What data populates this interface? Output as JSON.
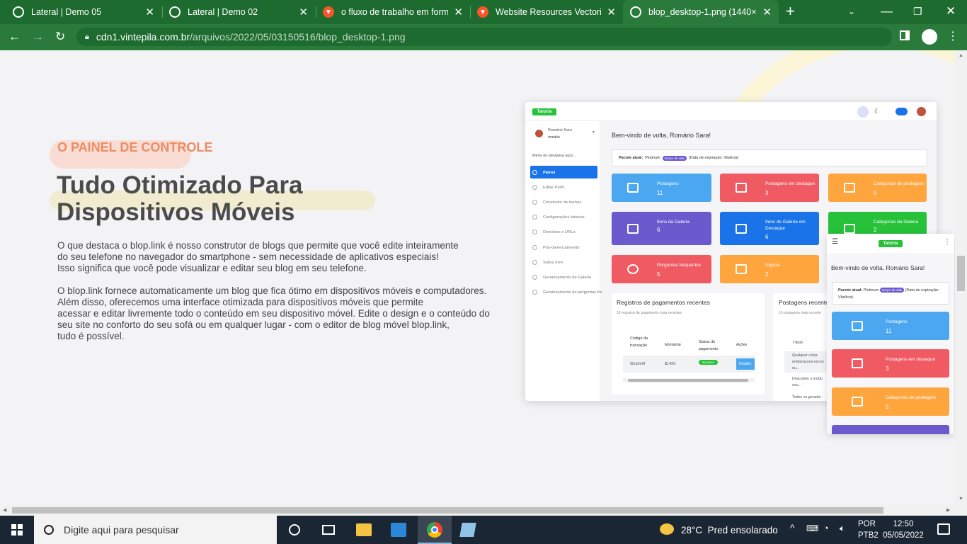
{
  "browser": {
    "tabs": [
      {
        "title": "Lateral | Demo 05",
        "icon": "globe-icon"
      },
      {
        "title": "Lateral | Demo 02",
        "icon": "globe-icon"
      },
      {
        "title": "o fluxo de trabalho em forma",
        "icon": "brave-icon"
      },
      {
        "title": "Website Resources Vectorie!",
        "icon": "brave-icon"
      },
      {
        "title": "blop_desktop-1.png (1440×7",
        "icon": "globe-icon"
      }
    ],
    "url_domain": "cdn1.vintepila.com.br",
    "url_path": "/arquivos/2022/05/03150516/blop_desktop-1.png"
  },
  "page": {
    "eyebrow": "O PAINEL DE CONTROLE",
    "heading_line1": "Tudo Otimizado Para",
    "heading_line2": "Dispositivos Móveis",
    "para1": [
      "O que destaca o blop.link é nosso construtor de blogs que permite que você edite inteiramente",
      "do seu telefone no navegador do smartphone - sem necessidade de aplicativos especiais!",
      "Isso significa que você pode visualizar e editar seu blog em seu telefone."
    ],
    "para2": [
      "O blop.link fornece automaticamente um blog que fica ótimo em dispositivos móveis e computadores.",
      "Além disso, oferecemos uma interface otimizada para dispositivos móveis que permite",
      "acessar e editar livremente todo o conteúdo em seu dispositivo móvel. Edite o design e o conteúdo do",
      "seu site no conforto do seu sofá ou em qualquer lugar - com o editor de blog móvel blop.link,",
      "tudo é possível."
    ]
  },
  "mock": {
    "logo": "Tanzria",
    "user_name": "Romário Sara",
    "user_handle": "romário",
    "search_placeholder": "Menu de pesquisa aqui...",
    "nav": [
      "Painel",
      "Editar Perfil",
      "Construtor de menus",
      "Configurações básicas",
      "Domínios e URLs",
      "Pós-Gerenciamento",
      "Sobre mim",
      "Gerenciamento de Galeria",
      "Gerenciamento de perguntas fre"
    ],
    "welcome": "Bem-vindo de volta, Romário Sara!",
    "package_label": "Pacote atual:",
    "package_name": "Plutinum",
    "package_badge": "tempo de vida",
    "package_expiry": "(Data de expiração: Vitalícia)",
    "cards": [
      {
        "label": "Postagens",
        "value": "11",
        "color": "#4ba8f0"
      },
      {
        "label": "Postagens em destaque",
        "value": "3",
        "color": "#ef5a63"
      },
      {
        "label": "Categorias de postagem",
        "value": "5",
        "color": "#ffa53d"
      },
      {
        "label": "Itens da Galeria",
        "value": "6",
        "color": "#6a5acd"
      },
      {
        "label": "Itens de Galeria em Destaque",
        "value": "6",
        "color": "#1a73e8"
      },
      {
        "label": "Categorias da Galeria",
        "value": "2",
        "color": "#27c23a"
      },
      {
        "label": "Perguntas frequentes",
        "value": "5",
        "color": "#ef5a63"
      },
      {
        "label": "línguas",
        "value": "2",
        "color": "#ffa53d"
      }
    ],
    "payments_title": "Registros de pagamentos recentes",
    "payments_sub": "10 registros de pagamento mais recentes",
    "payments_cols": [
      "Código da transação",
      "Montante",
      "Status do pagamento",
      "Ações"
    ],
    "payments_row": [
      "95cbfe9f",
      "$1499",
      "Sucesso",
      "Detalhe"
    ],
    "posts_title": "Postagens recente",
    "posts_sub": "10 postagens mais recente",
    "posts_col": "Título",
    "posts_rows": [
      "Qualquer coisa embaraçosa escon eu...",
      "Descobriu o indub sou...",
      "Todos os gerador"
    ],
    "mobile_cards": [
      {
        "label": "Postagens",
        "value": "11",
        "color": "#4ba8f0"
      },
      {
        "label": "Postagens em destaque",
        "value": "3",
        "color": "#ef5a63"
      },
      {
        "label": "Categorias de postagem",
        "value": "5",
        "color": "#ffa53d"
      }
    ]
  },
  "taskbar": {
    "search_placeholder": "Digite aqui para pesquisar",
    "weather": "28°C  Pred ensolarado",
    "lang1": "POR",
    "lang2": "PTB2",
    "time": "12:50",
    "date": "05/05/2022"
  }
}
